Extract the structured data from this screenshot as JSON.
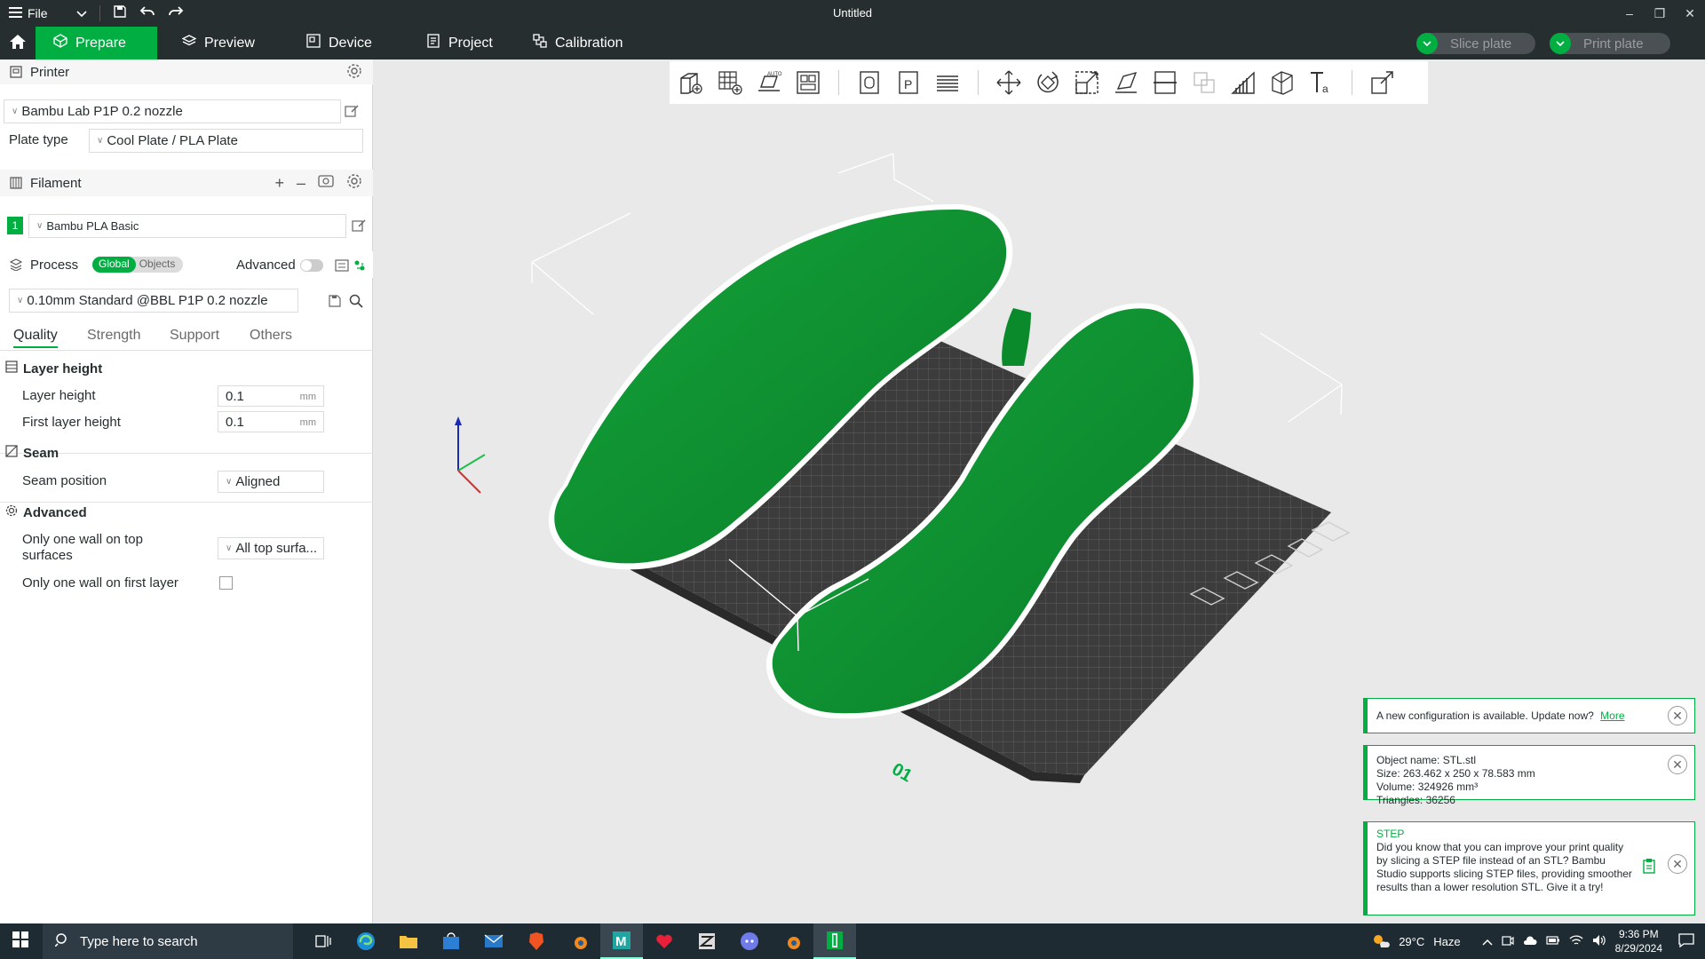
{
  "titlebar": {
    "file_label": "File",
    "title": "Untitled"
  },
  "tabs": {
    "prepare": "Prepare",
    "preview": "Preview",
    "device": "Device",
    "project": "Project",
    "calibration": "Calibration"
  },
  "actions": {
    "slice_plate": "Slice plate",
    "print_plate": "Print plate"
  },
  "printer": {
    "header": "Printer",
    "selected": "Bambu Lab P1P 0.2 nozzle",
    "plate_type_label": "Plate type",
    "plate_type_value": "Cool Plate / PLA Plate"
  },
  "filament": {
    "header": "Filament",
    "slot_number": "1",
    "slot_color": "#00ae42",
    "selected": "Bambu PLA Basic"
  },
  "process": {
    "header": "Process",
    "scope_global": "Global",
    "scope_objects": "Objects",
    "advanced_label": "Advanced",
    "advanced_on": false,
    "preset": "0.10mm Standard @BBL P1P 0.2 nozzle",
    "subtabs": [
      "Quality",
      "Strength",
      "Support",
      "Others"
    ],
    "active_subtab": "Quality"
  },
  "quality": {
    "layer_height_group": "Layer height",
    "layer_height_label": "Layer height",
    "layer_height_value": "0.1",
    "first_layer_height_label": "First layer height",
    "first_layer_height_value": "0.1",
    "unit": "mm",
    "seam_group": "Seam",
    "seam_position_label": "Seam position",
    "seam_position_value": "Aligned",
    "advanced_group": "Advanced",
    "one_wall_top_label": "Only one wall on top surfaces",
    "one_wall_top_value": "All top surfa...",
    "one_wall_first_label": "Only one wall on first layer",
    "one_wall_first_checked": false
  },
  "viewport": {
    "plate_number": "01",
    "model_color": "#0a8f2f",
    "bed_color": "#3c3c3c"
  },
  "notifications": {
    "config": {
      "text": "A new configuration is available. Update now?",
      "link": "More"
    },
    "object": {
      "name": "Object name: STL.stl",
      "size": "Size: 263.462 x 250 x 78.583 mm",
      "volume": "Volume: 324926 mm³",
      "triangles": "Triangles: 36256"
    },
    "step": {
      "title": "STEP",
      "body": "Did you know that you can improve your print quality by slicing a STEP file instead of an STL? Bambu Studio supports slicing STEP files, providing smoother results than a lower resolution STL. Give it a try!"
    }
  },
  "taskbar": {
    "search_placeholder": "Type here to search",
    "weather_temp": "29°C",
    "weather_desc": "Haze",
    "time": "9:36 PM",
    "date": "8/29/2024"
  }
}
